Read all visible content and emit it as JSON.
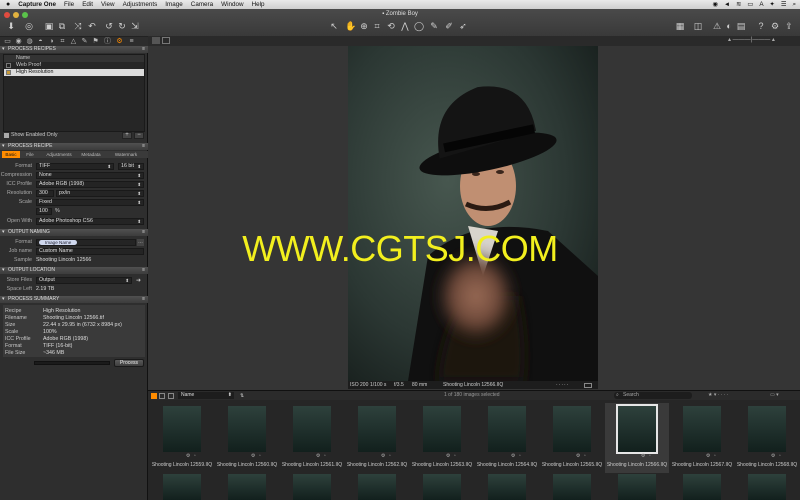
{
  "menubar": {
    "apple": "",
    "items": [
      "Capture One",
      "File",
      "Edit",
      "View",
      "Adjustments",
      "Image",
      "Camera",
      "Window",
      "Help"
    ],
    "status_icons": [
      "camera-status-icon",
      "volume-icon",
      "wifi-icon",
      "battery-icon",
      "font-icon",
      "magic-wand-icon",
      "notifications-icon",
      "spotlight-icon"
    ]
  },
  "window": {
    "title": "Zombie Boy"
  },
  "process_recipes": {
    "header": "PROCESS RECIPES",
    "column": "Name",
    "items": [
      {
        "name": "Web Proof",
        "checked": false
      },
      {
        "name": "High Resolution",
        "checked": true,
        "selected": true
      }
    ],
    "show_enabled": "Show Enabled Only",
    "add": "+",
    "remove": "−"
  },
  "process_recipe": {
    "header": "PROCESS RECIPE",
    "tabs": [
      "Basic",
      "File",
      "Adjustments",
      "Metadata",
      "Watermark"
    ],
    "fields": {
      "format_label": "Format",
      "format": "TIFF",
      "bit_depth": "16 bit",
      "compression_label": "Compression",
      "compression": "None",
      "icc_label": "ICC Profile",
      "icc": "Adobe RGB (1998)",
      "resolution_label": "Resolution",
      "resolution": "300",
      "resolution_unit": "px/in",
      "scale_label": "Scale",
      "scale": "Fixed",
      "scale_value": "100",
      "scale_unit": "%",
      "open_with_label": "Open With",
      "open_with": "Adobe Photoshop CS6"
    }
  },
  "output_naming": {
    "header": "OUTPUT NAMING",
    "format_label": "Format",
    "format_token": "Image Name",
    "jobname_label": "Job name",
    "jobname": "Custom Name",
    "sample_label": "Sample",
    "sample": "Shooting Lincoln 12566"
  },
  "output_location": {
    "header": "OUTPUT LOCATION",
    "store_label": "Store Files",
    "store": "Output",
    "space_label": "Space Left",
    "space": "2.19 TB"
  },
  "process_summary": {
    "header": "PROCESS SUMMARY",
    "rows": [
      {
        "k": "Recipe",
        "v": "High Resolution"
      },
      {
        "k": "Filename",
        "v": "Shooting Lincoln 12566.tif"
      },
      {
        "k": "Size",
        "v": "22.44 x 29.95 in (6732 x 8984 px)"
      },
      {
        "k": "Scale",
        "v": "100%"
      },
      {
        "k": "ICC Profile",
        "v": "Adobe RGB (1998)"
      },
      {
        "k": "Format",
        "v": "TIFF (16-bit)"
      },
      {
        "k": "File Size",
        "v": "~346 MB"
      }
    ],
    "process_button": "Process"
  },
  "viewer": {
    "caption": {
      "iso": "ISO 200",
      "shutter": "1/100 s",
      "aperture": "f/3.5",
      "focal": "80 mm",
      "filename": "Shooting Lincoln 12566.IIQ"
    }
  },
  "watermark": "WWW.CGTSJ.COM",
  "browser": {
    "sort_label": "Name",
    "selection_count": "1 of 180 images selected",
    "search_placeholder": "Search",
    "selected_index": 7,
    "thumbnails": [
      "Shooting Lincoln 12559.IIQ",
      "Shooting Lincoln 12560.IIQ",
      "Shooting Lincoln 12561.IIQ",
      "Shooting Lincoln 12562.IIQ",
      "Shooting Lincoln 12563.IIQ",
      "Shooting Lincoln 12564.IIQ",
      "Shooting Lincoln 12565.IIQ",
      "Shooting Lincoln 12566.IIQ",
      "Shooting Lincoln 12567.IIQ",
      "Shooting Lincoln 12568.IIQ"
    ]
  },
  "colors": {
    "accent": "#ff8c00",
    "watermark": "#f2ef1e",
    "panel": "#2e2e2e",
    "header": "#454545"
  }
}
